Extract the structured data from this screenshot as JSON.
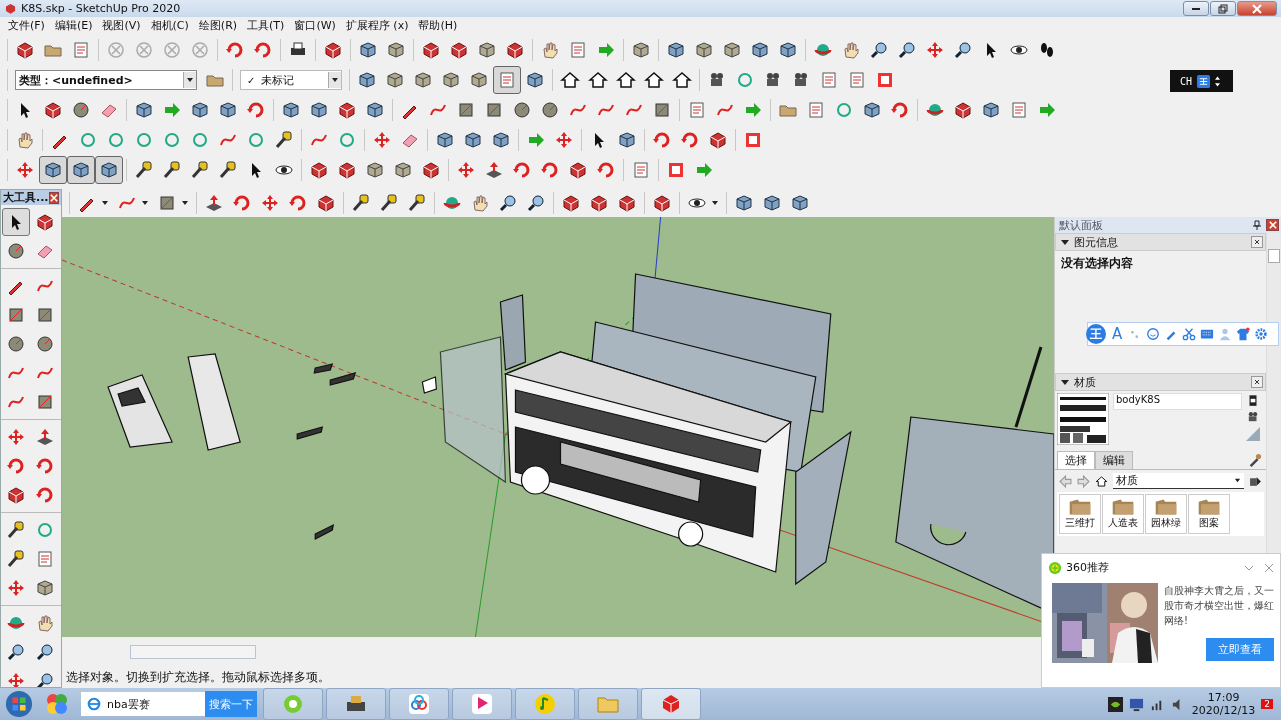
{
  "window": {
    "title": "K8S.skp - SketchUp Pro 2020"
  },
  "menu": [
    "文件(F)",
    "编辑(E)",
    "视图(V)",
    "相机(C)",
    "绘图(R)",
    "工具(T)",
    "窗口(W)",
    "扩展程序 (x)",
    "帮助(H)"
  ],
  "type_dropdown": {
    "label": "类型：",
    "value": "<undefined>"
  },
  "tag_dropdown": {
    "check": "✓",
    "value": "未标记"
  },
  "face_styles": [
    {
      "selected": false
    },
    {
      "selected": false
    },
    {
      "selected": false
    },
    {
      "selected": false
    },
    {
      "selected": false
    },
    {
      "selected": true
    },
    {
      "selected": false
    }
  ],
  "view_modes": [
    {
      "selected": false
    },
    {
      "selected": true
    },
    {
      "selected": true
    },
    {
      "selected": true
    }
  ],
  "ime_indicator": {
    "lang": "CH"
  },
  "tool_palette": {
    "title": "大工具...",
    "groups": [
      [
        {
          "selected": true
        },
        {
          "selected": false
        },
        {
          "selected": false
        },
        {
          "selected": false
        }
      ],
      [
        {
          "selected": false
        },
        {
          "selected": false
        },
        {
          "selected": false
        },
        {
          "selected": false
        },
        {
          "selected": false
        },
        {
          "selected": false
        },
        {
          "selected": false
        },
        {
          "selected": false
        },
        {
          "selected": false
        },
        {
          "selected": false
        }
      ],
      [
        {
          "selected": false
        },
        {
          "selected": false
        },
        {
          "selected": false
        },
        {
          "selected": false
        },
        {
          "selected": false
        },
        {
          "selected": false
        }
      ],
      [
        {
          "selected": false
        },
        {
          "selected": false
        },
        {
          "selected": false
        },
        {
          "selected": false
        },
        {
          "selected": false
        },
        {
          "selected": false
        }
      ],
      [
        {
          "selected": false
        },
        {
          "selected": false
        },
        {
          "selected": false
        },
        {
          "selected": false
        },
        {
          "selected": false
        },
        {
          "selected": false
        }
      ]
    ]
  },
  "panel": {
    "title": "默认面板",
    "entity_info": {
      "title": "图元信息",
      "expanded": true,
      "text": "没有选择内容"
    },
    "materials": {
      "title": "材质",
      "expanded": true,
      "name": "bodyK8S",
      "tabs": [
        {
          "label": "选择",
          "selected": true
        },
        {
          "label": "编辑",
          "selected": false
        }
      ],
      "library": "材质",
      "folders": [
        "三维打",
        "人造表",
        "园林绿",
        "图案"
      ]
    }
  },
  "ime_toolbar": {
    "logo": "王",
    "letter": "A"
  },
  "status": {
    "text": "选择对象。切换到扩充选择。拖动鼠标选择多项。"
  },
  "taskbar": {
    "search": {
      "value": "nba罢赛",
      "button": "搜索一下"
    },
    "time": "17:09",
    "date": "2020/12/13",
    "badge": "2"
  },
  "ad": {
    "title": "360推荐",
    "text": "自股神李大霄之后，又一股市奇才横空出世，爆红网络!",
    "button": "立即查看"
  }
}
